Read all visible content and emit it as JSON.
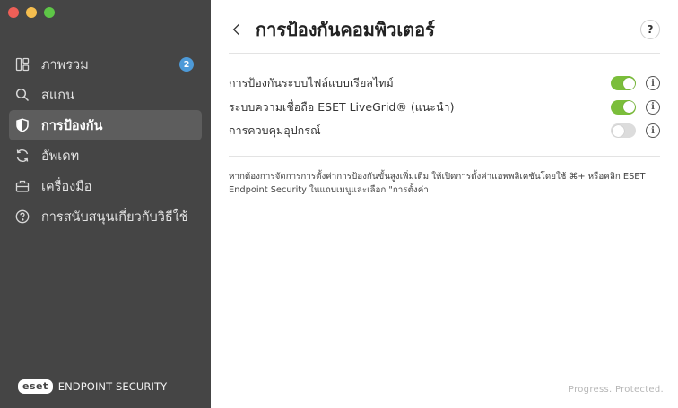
{
  "window": {
    "controls": [
      "close",
      "minimize",
      "zoom"
    ]
  },
  "sidebar": {
    "items": [
      {
        "icon": "overview-icon",
        "label": "ภาพรวม",
        "badge": "2",
        "active": false
      },
      {
        "icon": "search-icon",
        "label": "สแกน",
        "active": false
      },
      {
        "icon": "shield-icon",
        "label": "การป้องกัน",
        "active": true
      },
      {
        "icon": "update-icon",
        "label": "อัพเดท",
        "active": false
      },
      {
        "icon": "toolbox-icon",
        "label": "เครื่องมือ",
        "active": false
      },
      {
        "icon": "help-circle-icon",
        "label": "การสนับสนุนเกี่ยวกับวิธีใช้",
        "active": false
      }
    ],
    "brand": {
      "logo": "eset",
      "product": "ENDPOINT SECURITY"
    }
  },
  "header": {
    "title": "การป้องกันคอมพิวเตอร์",
    "help": "?"
  },
  "settings": [
    {
      "label": "การป้องกันระบบไฟล์แบบเรียลไทม์",
      "enabled": true
    },
    {
      "label": "ระบบความเชื่อถือ ESET LiveGrid® (แนะนำ)",
      "enabled": true
    },
    {
      "label": "การควบคุมอุปกรณ์",
      "enabled": false
    }
  ],
  "description": "หากต้องการจัดการการตั้งค่าการป้องกันขั้นสูงเพิ่มเติม ให้เปิดการตั้งค่าแอพพลิเคชันโดยใช้ ⌘+ หรือคลิก ESET Endpoint Security ในแถบเมนูและเลือก \"การตั้งค่า",
  "tagline": "Progress. Protected.",
  "colors": {
    "sidebar_bg": "#454545",
    "active_item": "#5d5d5d",
    "toggle_on": "#7bbe3b",
    "badge": "#4d9ad8"
  }
}
